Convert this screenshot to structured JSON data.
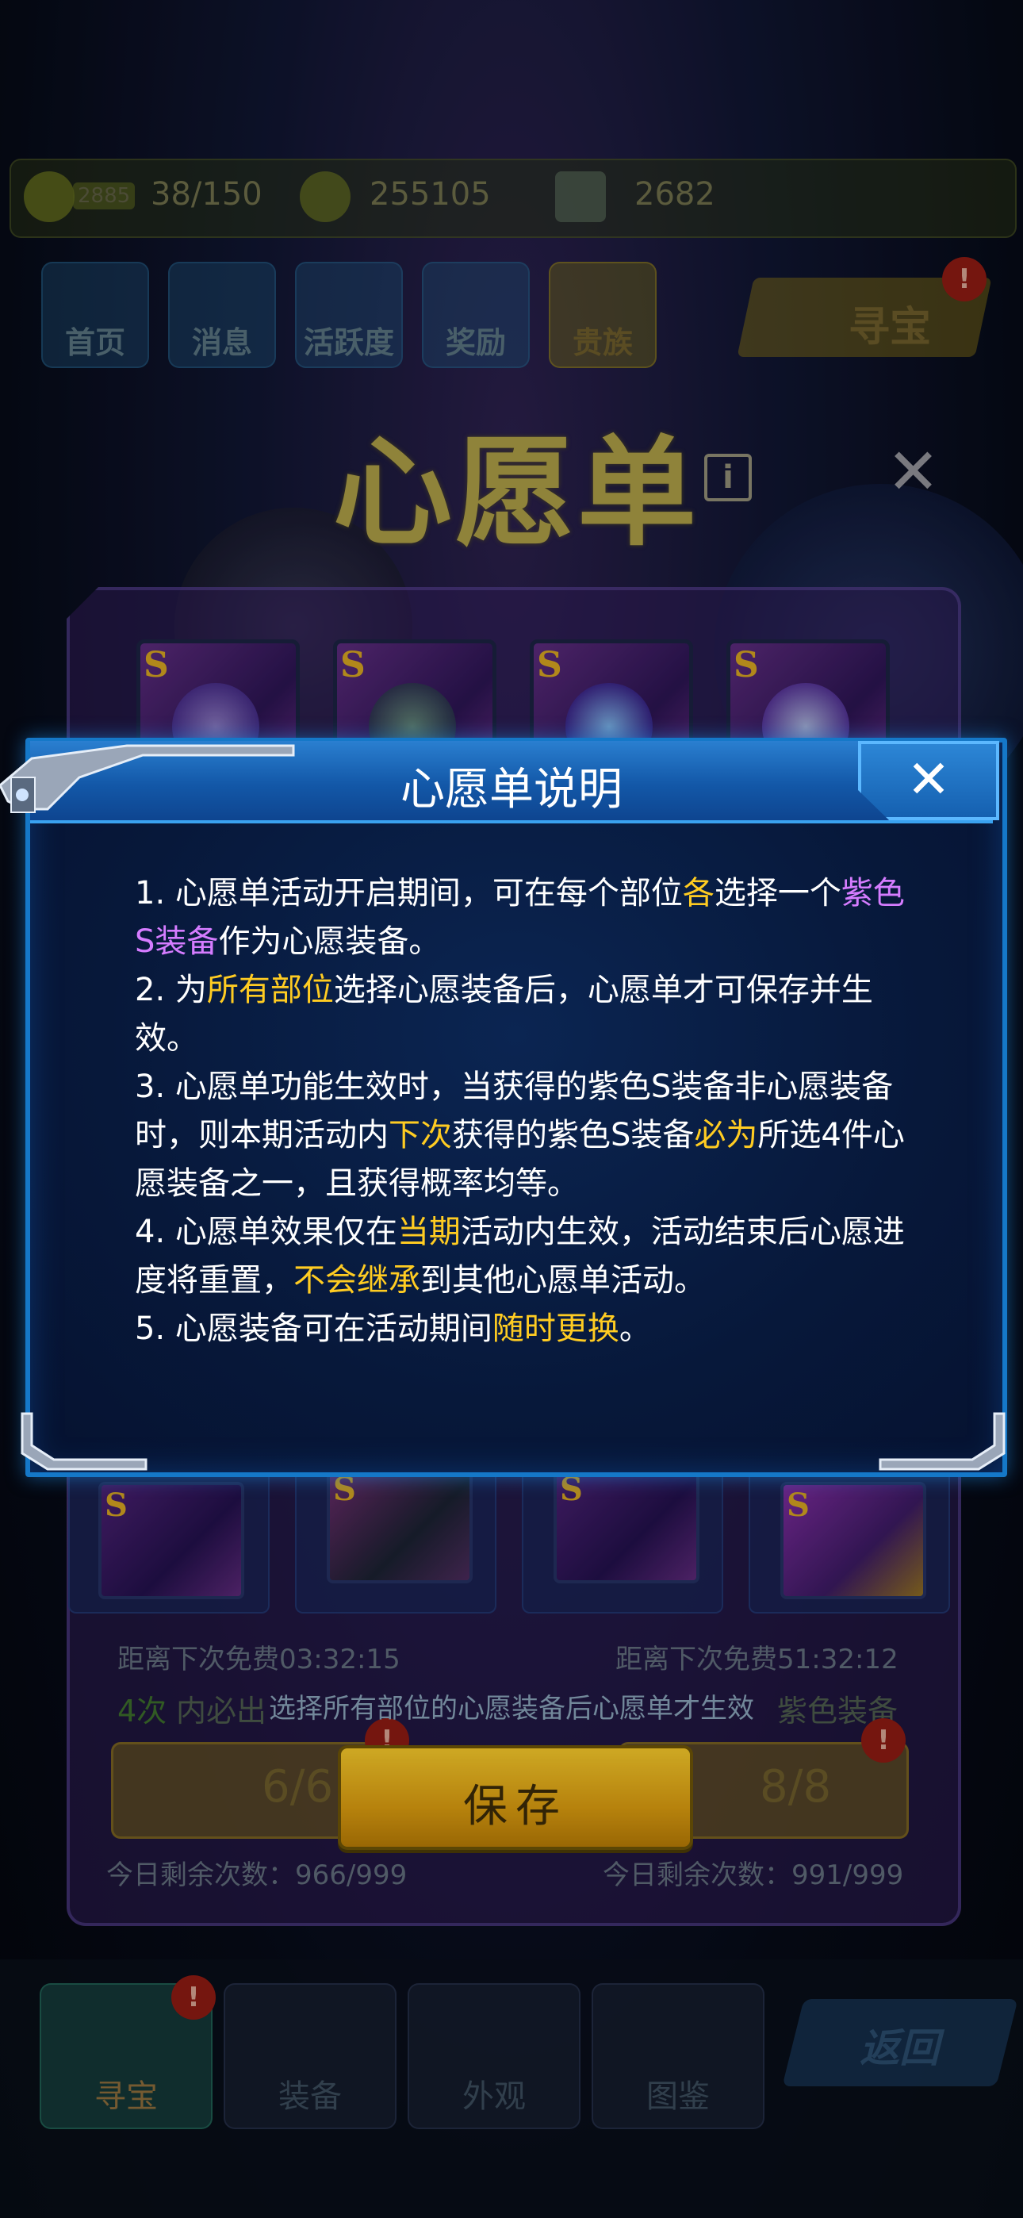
{
  "resources": {
    "stamina": "38/150",
    "stamina_tag": "2885",
    "gold": "255105",
    "gems": "2682"
  },
  "top_nav": [
    "首页",
    "消息",
    "活跃度",
    "奖励",
    "贵族"
  ],
  "treasure_top_label": "寻宝",
  "badge_mark": "!",
  "page_title": "心愿单",
  "info_icon_glyph": "i",
  "close_glyph": "✕",
  "slot_grade": "S",
  "bottom_slot_grade": "S",
  "timers": {
    "left": "距离下次免费03:32:15",
    "right": "距离下次免费51:32:12"
  },
  "chance": {
    "left_prefix": "4次",
    "left_suffix": "内必出",
    "right_suffix": "紫色装备"
  },
  "draw_buttons": {
    "left_count": "6/6",
    "right_count": "8/8"
  },
  "daily_left": {
    "left": "今日剩余次数：966/999",
    "right": "今日剩余次数：991/999"
  },
  "notice": "选择所有部位的心愿装备后心愿单才生效",
  "save_label": "保存",
  "bottom_tabs": [
    "寻宝",
    "装备",
    "外观",
    "图鉴"
  ],
  "back_label": "返回",
  "dialog": {
    "title": "心愿单说明",
    "close_glyph": "✕",
    "rules": [
      {
        "a": "1. 心愿单活动开启期间，可在每个部位",
        "b": "各",
        "c": "选择一个",
        "d": "紫色S装备",
        "e": "作为心愿装备。"
      },
      {
        "a": "2. 为",
        "b": "所有部位",
        "c": "选择心愿装备后，心愿单才可保存并生效。"
      },
      {
        "a": "3. 心愿单功能生效时，当获得的紫色S装备非心愿装备时，则本期活动内",
        "b": "下次",
        "c": "获得的紫色S装备",
        "d": "必为",
        "e": "所选4件心愿装备之一，且获得概率均等。"
      },
      {
        "a": "4. 心愿单效果仅在",
        "b": "当期",
        "c": "活动内生效，活动结束后心愿进度将重置，",
        "d": "不会继承",
        "e": "到其他心愿单活动。"
      },
      {
        "a": "5. 心愿装备可在活动期间",
        "b": "随时更换",
        "c": "。"
      }
    ]
  },
  "colors": {
    "highlight_yellow": "#ffcc22",
    "highlight_purple": "#d57cff",
    "frame_blue": "#1578c8",
    "save_gold": "#f2c62a"
  }
}
